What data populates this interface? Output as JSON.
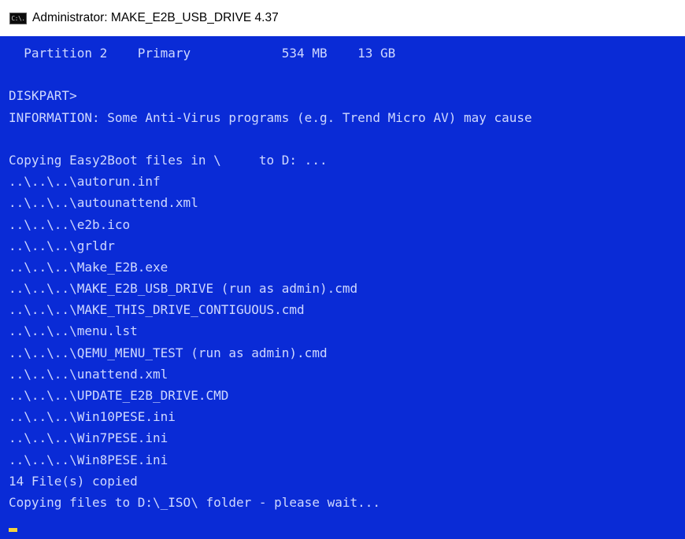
{
  "window": {
    "title": "Administrator: MAKE_E2B_USB_DRIVE 4.37",
    "icon": "console-icon",
    "icon_glyph": "C:\\."
  },
  "colors": {
    "console_background": "#0a2bd6",
    "console_text": "#cfd8ff",
    "cursor": "#f4d23c"
  },
  "console": {
    "lines": [
      "  Partition 2    Primary            534 MB    13 GB",
      "",
      "DISKPART>",
      "INFORMATION: Some Anti-Virus programs (e.g. Trend Micro AV) may cause",
      "",
      "Copying Easy2Boot files in \\     to D: ...",
      "..\\..\\..\\autorun.inf",
      "..\\..\\..\\autounattend.xml",
      "..\\..\\..\\e2b.ico",
      "..\\..\\..\\grldr",
      "..\\..\\..\\Make_E2B.exe",
      "..\\..\\..\\MAKE_E2B_USB_DRIVE (run as admin).cmd",
      "..\\..\\..\\MAKE_THIS_DRIVE_CONTIGUOUS.cmd",
      "..\\..\\..\\menu.lst",
      "..\\..\\..\\QEMU_MENU_TEST (run as admin).cmd",
      "..\\..\\..\\unattend.xml",
      "..\\..\\..\\UPDATE_E2B_DRIVE.CMD",
      "..\\..\\..\\Win10PESE.ini",
      "..\\..\\..\\Win7PESE.ini",
      "..\\..\\..\\Win8PESE.ini",
      "14 File(s) copied",
      "Copying files to D:\\_ISO\\ folder - please wait..."
    ]
  }
}
